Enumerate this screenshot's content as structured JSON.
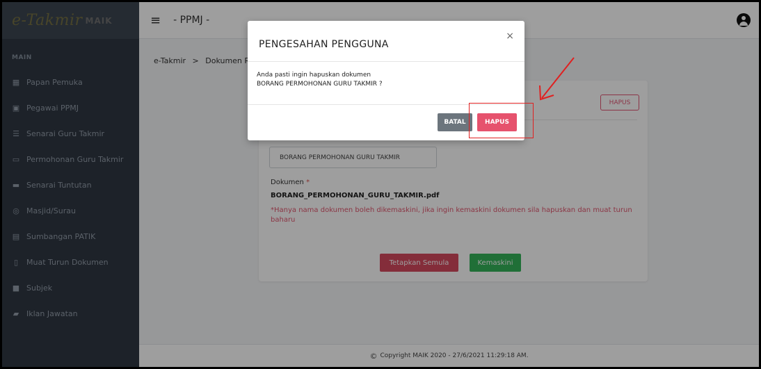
{
  "logo": {
    "text": "e-Takmir",
    "suffix": "MAIK"
  },
  "sidebar": {
    "section": "MAIN",
    "items": [
      {
        "label": "Papan Pemuka",
        "icon": "dashboard-icon"
      },
      {
        "label": "Pegawai PPMJ",
        "icon": "id-card-icon"
      },
      {
        "label": "Senarai Guru Takmir",
        "icon": "list-icon"
      },
      {
        "label": "Permohonan Guru Takmir",
        "icon": "monitor-icon"
      },
      {
        "label": "Senarai Tuntutan",
        "icon": "folder-icon"
      },
      {
        "label": "Masjid/Surau",
        "icon": "location-pin-icon"
      },
      {
        "label": "Sumbangan PATIK",
        "icon": "money-icon"
      },
      {
        "label": "Muat Turun Dokumen",
        "icon": "document-icon"
      },
      {
        "label": "Subjek",
        "icon": "book-icon"
      },
      {
        "label": "Iklan Jawatan",
        "icon": "briefcase-icon"
      }
    ]
  },
  "header": {
    "title": "- PPMJ -"
  },
  "breadcrumb": {
    "root": "e-Takmir",
    "separator": ">",
    "current": "Dokumen Ro"
  },
  "card": {
    "hapus_label": "HAPUS",
    "document_name_value": "BORANG PERMOHONAN GURU TAKMIR",
    "document_label": "Dokumen",
    "required_mark": "*",
    "file_name": "BORANG_PERMOHONAN_GURU_TAKMIR.pdf",
    "note": "*Hanya nama dokumen boleh dikemaskini, jika ingin kemaskini dokumen sila hapuskan dan muat turun baharu",
    "reset_label": "Tetapkan Semula",
    "update_label": "Kemaskini"
  },
  "modal": {
    "title": "PENGESAHAN PENGGUNA",
    "close": "×",
    "message_line1": "Anda pasti ingin hapuskan dokumen",
    "message_line2": "BORANG PERMOHONAN GURU TAKMIR ?",
    "cancel_label": "BATAL",
    "confirm_label": "HAPUS"
  },
  "footer": {
    "text": "Copyright MAIK 2020 - 27/6/2021 11:29:18 AM."
  },
  "colors": {
    "sidebar_bg": "#2d3540",
    "danger": "#e6526d",
    "success": "#35b35a",
    "secondary": "#6c757d",
    "annotation": "#e02020"
  }
}
